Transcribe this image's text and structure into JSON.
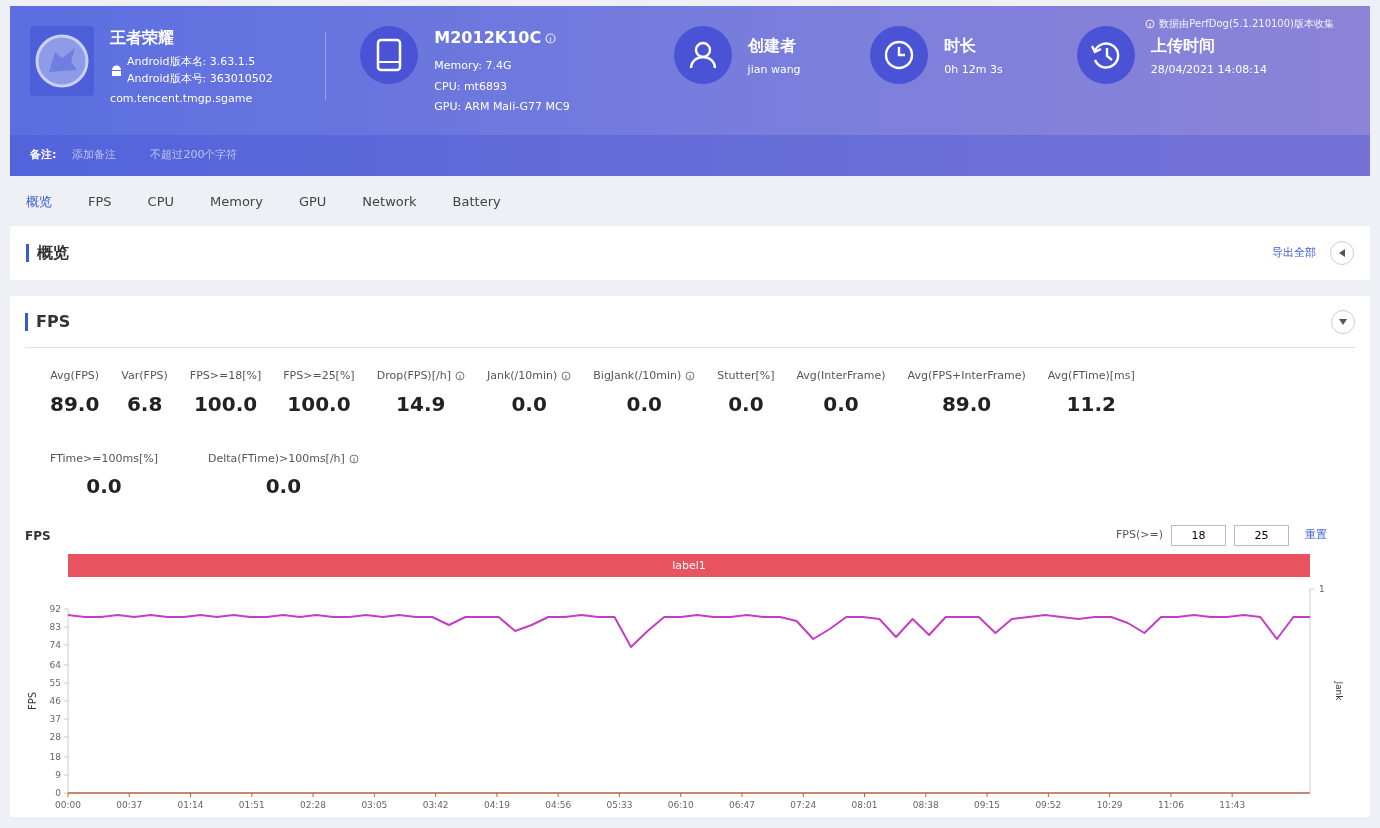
{
  "header": {
    "app": {
      "name": "王者荣耀",
      "version_name": "Android版本名: 3.63.1.5",
      "version_code": "Android版本号: 363010502",
      "package": "com.tencent.tmgp.sgame"
    },
    "device": {
      "model": "M2012K10C",
      "memory": "Memory: 7.4G",
      "cpu": "CPU: mt6893",
      "gpu": "GPU: ARM Mali-G77 MC9"
    },
    "stats": [
      {
        "kind": "user",
        "label": "创建者",
        "value": "jian wang"
      },
      {
        "kind": "clock",
        "label": "时长",
        "value": "0h 12m 3s"
      },
      {
        "kind": "history",
        "label": "上传时间",
        "value": "28/04/2021 14:08:14"
      }
    ],
    "collector_note": "数据由PerfDog(5.1.210100)版本收集",
    "remark": {
      "label": "备注:",
      "placeholder": "添加备注",
      "hint": "不超过200个字符"
    }
  },
  "tabs": [
    {
      "label": "概览",
      "selected": true
    },
    {
      "label": "FPS",
      "selected": false
    },
    {
      "label": "CPU",
      "selected": false
    },
    {
      "label": "Memory",
      "selected": false
    },
    {
      "label": "GPU",
      "selected": false
    },
    {
      "label": "Network",
      "selected": false
    },
    {
      "label": "Battery",
      "selected": false
    }
  ],
  "overview_section": {
    "title": "概览",
    "export_link": "导出全部",
    "expanded": false
  },
  "fps_section": {
    "title": "FPS",
    "expanded": true,
    "metric_rows": [
      [
        {
          "label": "Avg(FPS)",
          "value": "89.0",
          "info": false
        },
        {
          "label": "Var(FPS)",
          "value": "6.8",
          "info": false
        },
        {
          "label": "FPS>=18[%]",
          "value": "100.0",
          "info": false
        },
        {
          "label": "FPS>=25[%]",
          "value": "100.0",
          "info": false
        },
        {
          "label": "Drop(FPS)[/h]",
          "value": "14.9",
          "info": true
        },
        {
          "label": "Jank(/10min)",
          "value": "0.0",
          "info": true
        },
        {
          "label": "BigJank(/10min)",
          "value": "0.0",
          "info": true
        },
        {
          "label": "Stutter[%]",
          "value": "0.0",
          "info": false
        },
        {
          "label": "Avg(InterFrame)",
          "value": "0.0",
          "info": false
        },
        {
          "label": "Avg(FPS+InterFrame)",
          "value": "89.0",
          "info": false
        },
        {
          "label": "Avg(FTime)[ms]",
          "value": "11.2",
          "info": false
        }
      ],
      [
        {
          "label": "FTime>=100ms[%]",
          "value": "0.0",
          "info": false
        },
        {
          "label": "Delta(FTime)>100ms[/h]",
          "value": "0.0",
          "info": true
        }
      ]
    ],
    "chart": {
      "title": "FPS",
      "threshold_label": "FPS(>=)",
      "thresholds": [
        "18",
        "25"
      ],
      "reset_link": "重置",
      "label_bar": {
        "text": "label1",
        "color": "#e8535f"
      },
      "right_axis": {
        "label": "Jank",
        "tick": "1"
      },
      "chart_data": {
        "type": "line",
        "ylabel": "FPS",
        "x": [
          0,
          10,
          20,
          30,
          40,
          50,
          60,
          70,
          80,
          90,
          100,
          110,
          120,
          130,
          140,
          150,
          160,
          170,
          180,
          190,
          200,
          210,
          220,
          230,
          240,
          250,
          260,
          270,
          280,
          290,
          300,
          310,
          320,
          330,
          340,
          350,
          360,
          370,
          380,
          390,
          400,
          410,
          420,
          430,
          440,
          450,
          460,
          470,
          480,
          490,
          500,
          510,
          520,
          530,
          540,
          550,
          560,
          570,
          580,
          590,
          600,
          610,
          620,
          630,
          640,
          650,
          660,
          670,
          680,
          690,
          700,
          710,
          720,
          730,
          740,
          750
        ],
        "series": [
          {
            "color": "#c23fc4",
            "values": [
              89,
              88,
              88,
              89,
              88,
              89,
              88,
              88,
              89,
              88,
              89,
              88,
              88,
              89,
              88,
              89,
              88,
              88,
              89,
              88,
              89,
              88,
              88,
              84,
              88,
              88,
              88,
              81,
              84,
              88,
              88,
              89,
              88,
              88,
              73,
              81,
              88,
              88,
              89,
              88,
              88,
              89,
              88,
              88,
              86,
              77,
              82,
              88,
              88,
              87,
              78,
              87,
              79,
              88,
              88,
              88,
              80,
              87,
              88,
              89,
              88,
              87,
              88,
              88,
              85,
              80,
              88,
              88,
              89,
              88,
              88,
              89,
              88,
              77,
              88,
              88
            ]
          }
        ],
        "xlim": [
          0,
          750
        ],
        "ylim": [
          0,
          92
        ],
        "yticks": [
          0,
          9,
          18,
          28,
          37,
          46,
          55,
          64,
          74,
          83,
          92
        ],
        "xticks": [
          {
            "value": 0,
            "label": "00:00"
          },
          {
            "value": 37,
            "label": "00:37"
          },
          {
            "value": 74,
            "label": "01:14"
          },
          {
            "value": 111,
            "label": "01:51"
          },
          {
            "value": 148,
            "label": "02:28"
          },
          {
            "value": 185,
            "label": "03:05"
          },
          {
            "value": 222,
            "label": "03:42"
          },
          {
            "value": 259,
            "label": "04:19"
          },
          {
            "value": 296,
            "label": "04:56"
          },
          {
            "value": 333,
            "label": "05:33"
          },
          {
            "value": 370,
            "label": "06:10"
          },
          {
            "value": 407,
            "label": "06:47"
          },
          {
            "value": 444,
            "label": "07:24"
          },
          {
            "value": 481,
            "label": "08:01"
          },
          {
            "value": 518,
            "label": "08:38"
          },
          {
            "value": 555,
            "label": "09:15"
          },
          {
            "value": 592,
            "label": "09:52"
          },
          {
            "value": 629,
            "label": "10:29"
          },
          {
            "value": 666,
            "label": "11:06"
          },
          {
            "value": 703,
            "label": "11:43"
          }
        ]
      }
    }
  }
}
